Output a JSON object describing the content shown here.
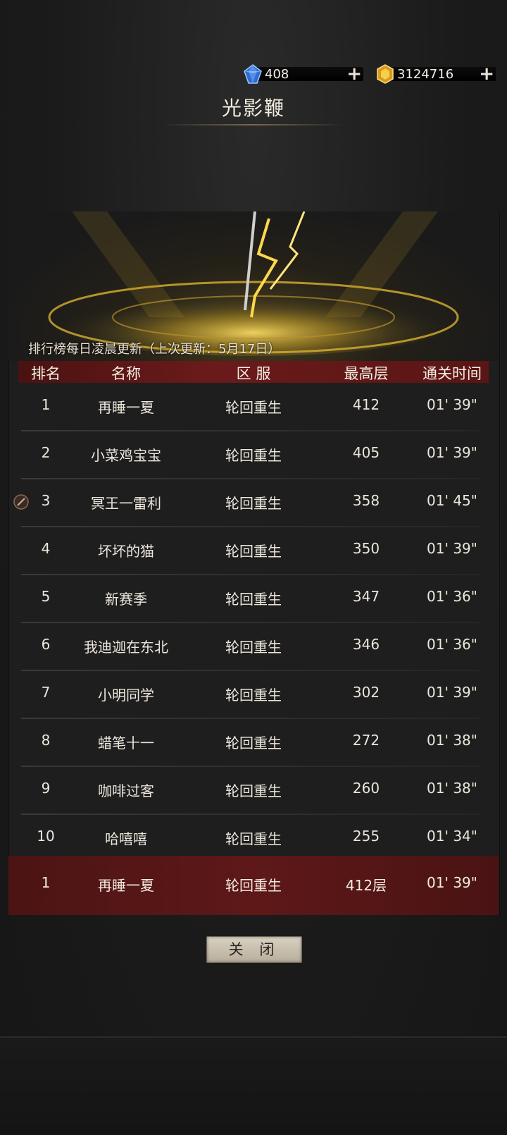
{
  "currency": {
    "gems": "408",
    "gold": "3124716",
    "plus_icon": "plus-icon"
  },
  "title": "光影鞭",
  "banner": {
    "note": "排行榜每日凌晨更新（上次更新：5月17日）"
  },
  "table": {
    "headers": [
      "排名",
      "名称",
      "区 服",
      "最高层",
      "通关时间"
    ],
    "rows": [
      {
        "rank": "1",
        "name": "再睡一夏",
        "server": "轮回重生",
        "floor": "412",
        "time": "01' 39\""
      },
      {
        "rank": "2",
        "name": "小菜鸡宝宝",
        "server": "轮回重生",
        "floor": "405",
        "time": "01' 39\""
      },
      {
        "rank": "3",
        "name": "冥王一雷利",
        "server": "轮回重生",
        "floor": "358",
        "time": "01' 45\""
      },
      {
        "rank": "4",
        "name": "坏坏的猫",
        "server": "轮回重生",
        "floor": "350",
        "time": "01' 39\""
      },
      {
        "rank": "5",
        "name": "新赛季",
        "server": "轮回重生",
        "floor": "347",
        "time": "01' 36\""
      },
      {
        "rank": "6",
        "name": "我迪迦在东北",
        "server": "轮回重生",
        "floor": "346",
        "time": "01' 36\""
      },
      {
        "rank": "7",
        "name": "小明同学",
        "server": "轮回重生",
        "floor": "302",
        "time": "01' 39\""
      },
      {
        "rank": "8",
        "name": "蜡笔十一",
        "server": "轮回重生",
        "floor": "272",
        "time": "01' 38\""
      },
      {
        "rank": "9",
        "name": "咖啡过客",
        "server": "轮回重生",
        "floor": "260",
        "time": "01' 38\""
      },
      {
        "rank": "10",
        "name": "哈嘻嘻",
        "server": "轮回重生",
        "floor": "255",
        "time": "01' 34\""
      }
    ],
    "self": {
      "rank": "1",
      "name": "再睡一夏",
      "server": "轮回重生",
      "floor": "412层",
      "time": "01' 39\""
    }
  },
  "close_button": "关 闭",
  "colors": {
    "header_red": "#6b1a1a",
    "self_row_red": "#5e1818",
    "gold_accent": "#e2b93b",
    "gem_blue": "#3c7bd9"
  }
}
